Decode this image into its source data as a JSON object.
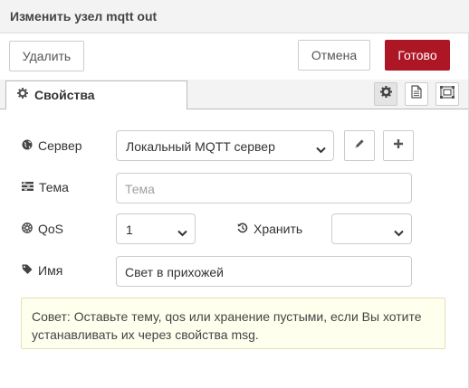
{
  "dialog": {
    "title": "Изменить узел mqtt out"
  },
  "toolbar": {
    "delete_label": "Удалить",
    "cancel_label": "Отмена",
    "done_label": "Готово"
  },
  "tabs": {
    "properties_label": "Свойства",
    "side_buttons": [
      "settings-icon",
      "description-icon",
      "appearance-icon"
    ]
  },
  "form": {
    "server": {
      "label": "Сервер",
      "value": "Локальный MQTT сервер"
    },
    "topic": {
      "label": "Тема",
      "value": "",
      "placeholder": "Тема"
    },
    "qos": {
      "label": "QoS",
      "value": "1"
    },
    "retain": {
      "label": "Хранить",
      "value": ""
    },
    "name": {
      "label": "Имя",
      "value": "Свет в прихожей"
    }
  },
  "tip": {
    "text": "Совет: Оставьте тему, qos или хранение пустыми, если Вы хотите устанавливать их через свойства msg."
  },
  "colors": {
    "primary": "#ad1625",
    "tip_background": "#ffffee"
  }
}
